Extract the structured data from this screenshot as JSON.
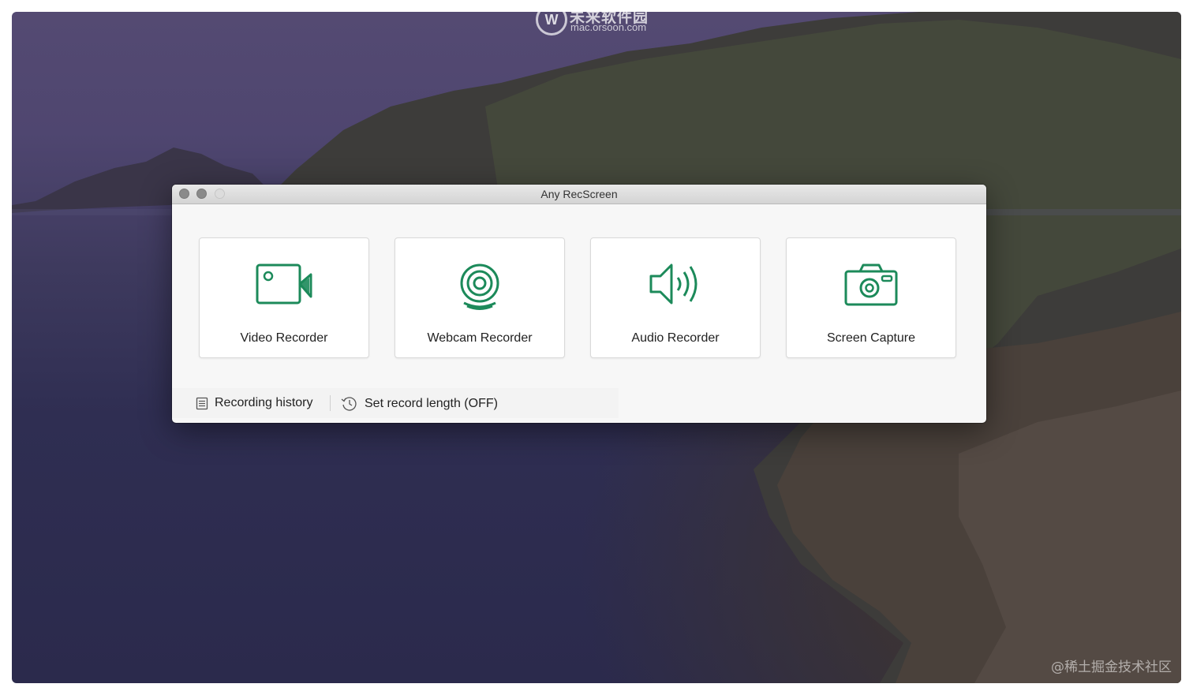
{
  "watermark": {
    "logo_text": "未来软件园",
    "logo_sub": "mac.orsoon.com",
    "corner_text": "@稀土掘金技术社区"
  },
  "window": {
    "title": "Any RecScreen"
  },
  "cards": [
    {
      "label": "Video Recorder",
      "icon": "video-camera-icon"
    },
    {
      "label": "Webcam Recorder",
      "icon": "webcam-icon"
    },
    {
      "label": "Audio Recorder",
      "icon": "speaker-icon"
    },
    {
      "label": "Screen Capture",
      "icon": "camera-icon"
    }
  ],
  "footer": {
    "history_label": "Recording history",
    "length_label": "Set record length (OFF)"
  },
  "colors": {
    "accent": "#1c8a5a",
    "window_bg": "#f7f7f7"
  }
}
